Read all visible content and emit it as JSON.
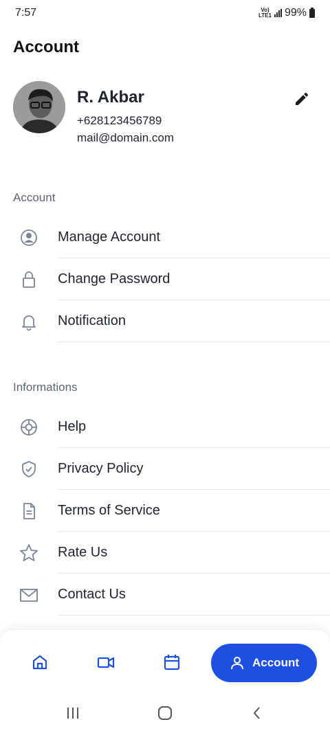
{
  "status_bar": {
    "time": "7:57",
    "network": "LTE1",
    "volte": "Vo)",
    "battery": "99%"
  },
  "page": {
    "title": "Account"
  },
  "profile": {
    "name": "R. Akbar",
    "phone": "+628123456789",
    "email": "mail@domain.com"
  },
  "sections": {
    "account": {
      "label": "Account",
      "items": [
        {
          "label": "Manage Account",
          "icon": "user-circle-icon"
        },
        {
          "label": "Change Password",
          "icon": "lock-icon"
        },
        {
          "label": "Notification",
          "icon": "bell-icon"
        }
      ]
    },
    "informations": {
      "label": "Informations",
      "items": [
        {
          "label": "Help",
          "icon": "lifebuoy-icon"
        },
        {
          "label": "Privacy Policy",
          "icon": "shield-check-icon"
        },
        {
          "label": "Terms of Service",
          "icon": "document-icon"
        },
        {
          "label": "Rate Us",
          "icon": "star-icon"
        },
        {
          "label": "Contact Us",
          "icon": "mail-icon"
        }
      ]
    }
  },
  "bottom_nav": {
    "items": [
      {
        "icon": "home-icon"
      },
      {
        "icon": "video-icon"
      },
      {
        "icon": "calendar-icon"
      }
    ],
    "active": {
      "label": "Account",
      "icon": "user-icon"
    }
  },
  "colors": {
    "accent": "#1f4fe0",
    "icon": "#7a8397",
    "text": "#1f2330",
    "muted": "#5f6472"
  }
}
